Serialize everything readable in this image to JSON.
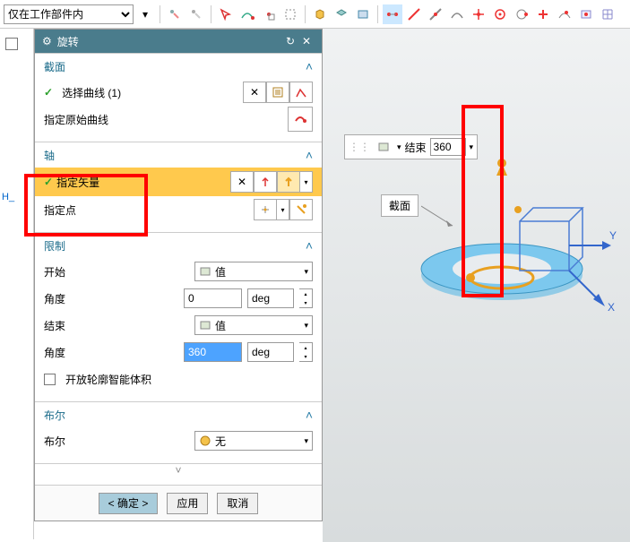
{
  "toolbar": {
    "filter_option": "仅在工作部件内"
  },
  "left_sidebar": {
    "tab_text": "H_"
  },
  "dialog": {
    "title": "旋转",
    "sections": {
      "section_curve": {
        "title": "截面",
        "select_curve": "选择曲线 (1)",
        "origin_curve": "指定原始曲线"
      },
      "axis": {
        "title": "轴",
        "specify_vector": "指定矢量",
        "specify_point": "指定点"
      },
      "limits": {
        "title": "限制",
        "start": "开始",
        "start_combo": "值",
        "start_angle_label": "角度",
        "start_angle_value": "0",
        "start_angle_unit": "deg",
        "end": "结束",
        "end_combo": "值",
        "end_angle_label": "角度",
        "end_angle_value": "360",
        "end_angle_unit": "deg",
        "open_profile": "开放轮廓智能体积"
      },
      "boolean": {
        "title": "布尔",
        "label": "布尔",
        "value": "无"
      }
    },
    "footer": {
      "ok": "< 确定 >",
      "apply": "应用",
      "cancel": "取消"
    }
  },
  "viewport": {
    "mini_toolbar": {
      "label": "结束",
      "value": "360"
    },
    "callout_label": "截面",
    "axis_y": "Y",
    "axis_x": "X"
  }
}
